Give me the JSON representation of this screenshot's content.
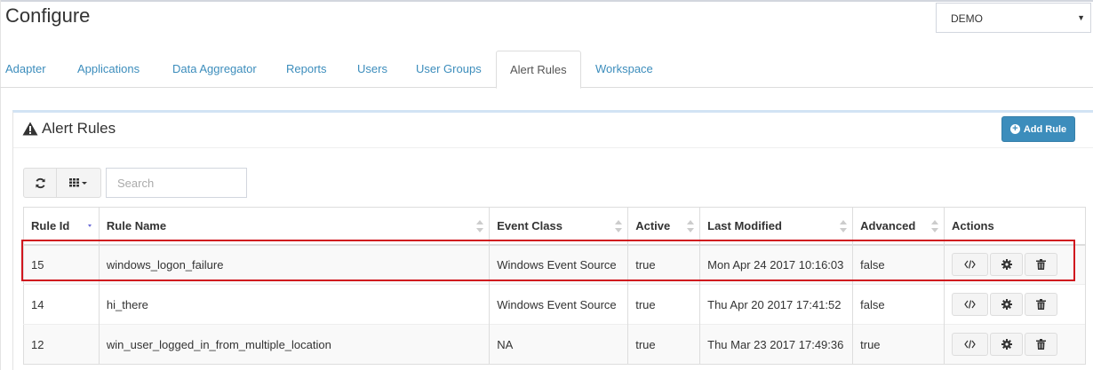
{
  "page": {
    "title": "Configure"
  },
  "environment": {
    "selected": "DEMO"
  },
  "tabs": [
    {
      "label": "Adapter"
    },
    {
      "label": "Applications"
    },
    {
      "label": "Data Aggregator"
    },
    {
      "label": "Reports"
    },
    {
      "label": "Users"
    },
    {
      "label": "User Groups"
    },
    {
      "label": "Alert Rules",
      "active": true
    },
    {
      "label": "Workspace"
    }
  ],
  "box": {
    "title": "Alert Rules",
    "add_button": "Add Rule"
  },
  "toolbar": {
    "search_placeholder": "Search"
  },
  "table": {
    "columns": [
      "Rule Id",
      "Rule Name",
      "Event Class",
      "Active",
      "Last Modified",
      "Advanced",
      "Actions"
    ],
    "rows": [
      {
        "id": "15",
        "name": "windows_logon_failure",
        "event_class": "Windows Event Source",
        "active": "true",
        "modified": "Mon Apr 24 2017 10:16:03",
        "advanced": "false"
      },
      {
        "id": "14",
        "name": "hi_there",
        "event_class": "Windows Event Source",
        "active": "true",
        "modified": "Thu Apr 20 2017 17:41:52",
        "advanced": "false"
      },
      {
        "id": "12",
        "name": "win_user_logged_in_from_multiple_location",
        "event_class": "NA",
        "active": "true",
        "modified": "Thu Mar 23 2017 17:49:36",
        "advanced": "true"
      }
    ]
  },
  "colors": {
    "accent": "#3c8dbc",
    "highlight": "#d0161e",
    "link": "#3c8dbc"
  },
  "icons": [
    "warning-icon",
    "plus-circle-icon",
    "refresh-icon",
    "columns-icon",
    "code-icon",
    "gear-icon",
    "trash-icon",
    "sort-icon"
  ]
}
